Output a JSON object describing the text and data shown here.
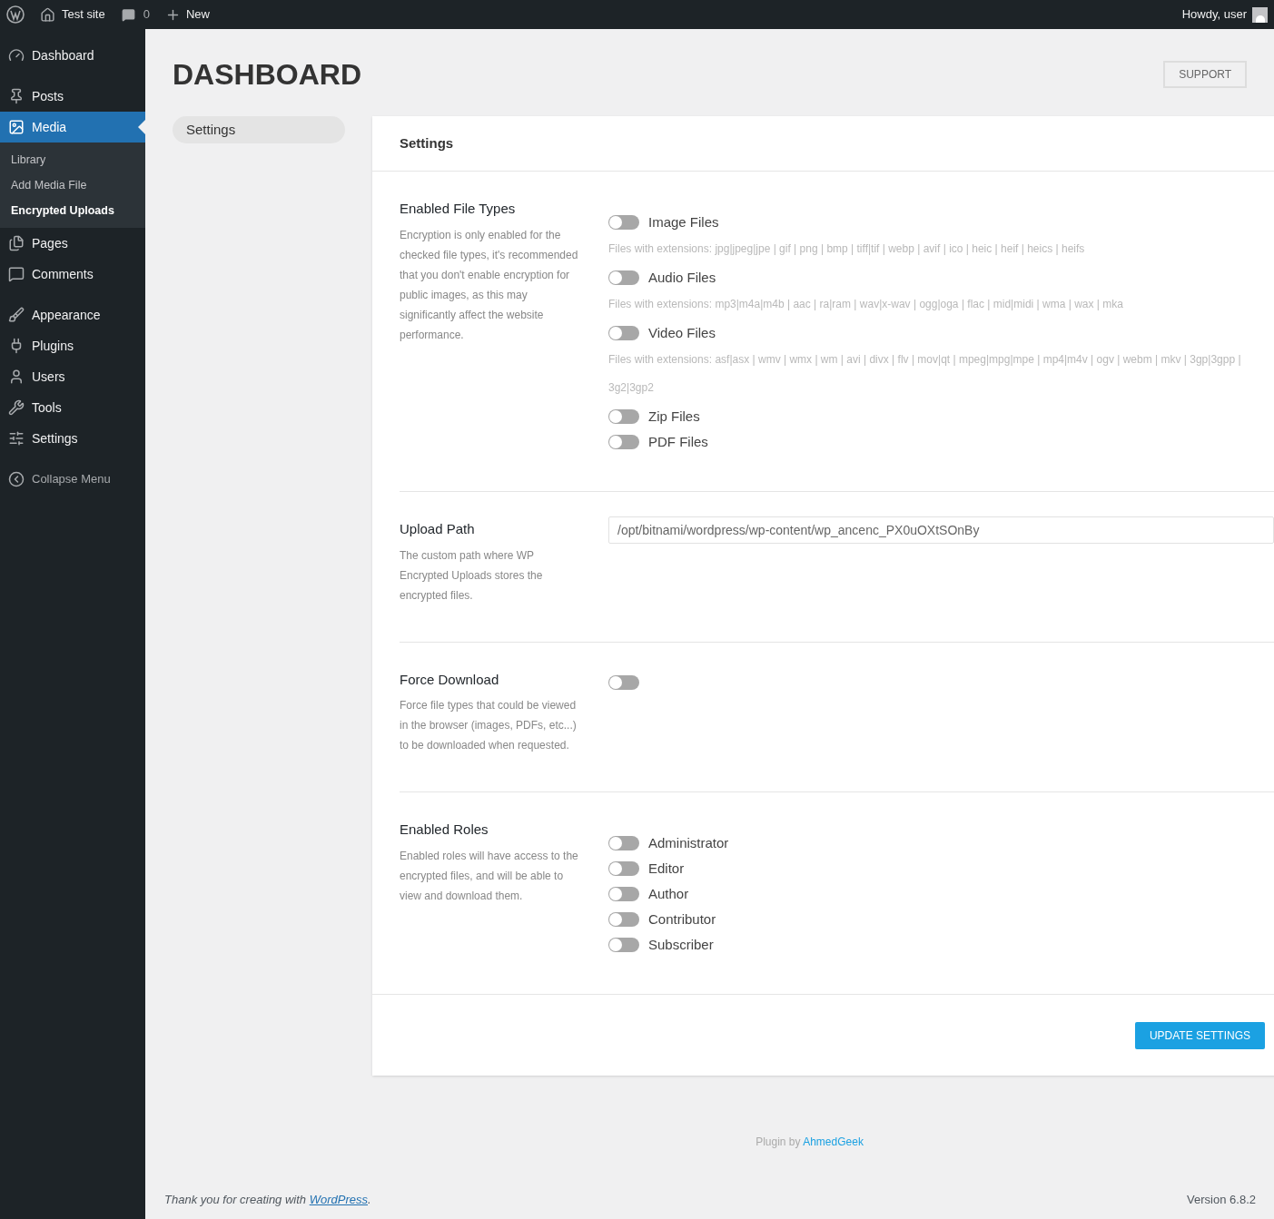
{
  "admin_bar": {
    "site": "Test site",
    "comments_count": "0",
    "new": "New",
    "greeting": "Howdy, user"
  },
  "sidebar": {
    "groups": [
      [
        {
          "label": "Dashboard",
          "kind": "dashboard",
          "selected": false
        }
      ],
      [
        {
          "label": "Posts",
          "kind": "posts",
          "selected": false
        },
        {
          "label": "Media",
          "kind": "media",
          "selected": true,
          "children": [
            {
              "label": "Library",
              "selected": false
            },
            {
              "label": "Add Media File",
              "selected": false
            },
            {
              "label": "Encrypted Uploads",
              "selected": true
            }
          ]
        },
        {
          "label": "Pages",
          "kind": "pages",
          "selected": false
        },
        {
          "label": "Comments",
          "kind": "comments",
          "selected": false
        }
      ],
      [
        {
          "label": "Appearance",
          "kind": "appearance",
          "selected": false
        },
        {
          "label": "Plugins",
          "kind": "plugins",
          "selected": false
        },
        {
          "label": "Users",
          "kind": "users",
          "selected": false
        },
        {
          "label": "Tools",
          "kind": "tools",
          "selected": false
        },
        {
          "label": "Settings",
          "kind": "settings",
          "selected": false
        }
      ]
    ],
    "collapse": "Collapse Menu"
  },
  "page": {
    "title": "DASHBOARD",
    "support_button": "SUPPORT"
  },
  "tabs": [
    {
      "label": "Settings",
      "selected": true
    }
  ],
  "card": {
    "title": "Settings",
    "sections": [
      {
        "kind": "toggles",
        "title": "Enabled File Types",
        "description": "Encryption is only enabled for the checked file types, it's recommended that you don't enable encryption for public images, as this may significantly affect the website performance.",
        "options": [
          {
            "label": "Image Files",
            "on": false,
            "hint": "Files with extensions: jpg|jpeg|jpe | gif | png | bmp | tiff|tif | webp | avif | ico | heic | heif | heics | heifs"
          },
          {
            "label": "Audio Files",
            "on": false,
            "hint": "Files with extensions: mp3|m4a|m4b | aac | ra|ram | wav|x-wav | ogg|oga | flac | mid|midi | wma | wax | mka"
          },
          {
            "label": "Video Files",
            "on": false,
            "hint": "Files with extensions: asf|asx | wmv | wmx | wm | avi | divx | flv | mov|qt | mpeg|mpg|mpe | mp4|m4v | ogv | webm | mkv | 3gp|3gpp | 3g2|3gp2"
          },
          {
            "label": "Zip Files",
            "on": false
          },
          {
            "label": "PDF Files",
            "on": false
          }
        ]
      },
      {
        "kind": "text",
        "title": "Upload Path",
        "description": "The custom path where WP Encrypted Uploads stores the encrypted files.",
        "value": "/opt/bitnami/wordpress/wp-content/wp_ancenc_PX0uOXtSOnBy"
      },
      {
        "kind": "toggles",
        "title": "Force Download",
        "description": "Force file types that could be viewed in the browser (images, PDFs, etc...) to be downloaded when requested.",
        "options": [
          {
            "on": false
          }
        ]
      },
      {
        "kind": "toggles",
        "title": "Enabled Roles",
        "description": "Enabled roles will have access to the encrypted files, and will be able to view and download them.",
        "options": [
          {
            "label": "Administrator",
            "on": false
          },
          {
            "label": "Editor",
            "on": false
          },
          {
            "label": "Author",
            "on": false
          },
          {
            "label": "Contributor",
            "on": false
          },
          {
            "label": "Subscriber",
            "on": false
          }
        ]
      }
    ],
    "submit": "UPDATE SETTINGS"
  },
  "credit": {
    "text": "Plugin by",
    "link": "AhmedGeek"
  },
  "footer": {
    "text": "Thank you for creating with",
    "link": "WordPress",
    "after": ".",
    "version": "Version 6.8.2"
  }
}
